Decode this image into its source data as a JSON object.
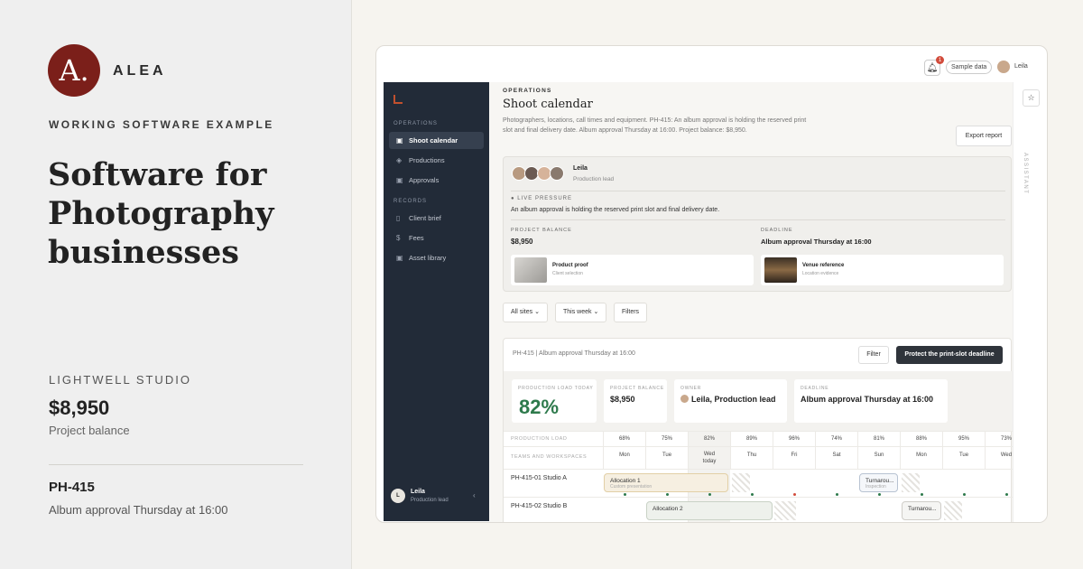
{
  "brand": {
    "logo_letter": "A.",
    "name": "ALEA"
  },
  "hero": {
    "eyebrow": "WORKING SOFTWARE EXAMPLE",
    "headline": "Software for Photography businesses"
  },
  "studio": {
    "name": "LIGHTWELL STUDIO",
    "balance": "$8,950",
    "balance_label": "Project balance",
    "code": "PH-415",
    "code_desc": "Album approval Thursday at 16:00"
  },
  "app": {
    "topbar": {
      "notifications": "1",
      "sample_label": "Sample data",
      "user": "Leila"
    },
    "sidebar": {
      "section_ops": "OPERATIONS",
      "ops_items": [
        {
          "label": "Shoot calendar",
          "icon": "camera-icon",
          "active": true
        },
        {
          "label": "Productions",
          "icon": "layers-icon"
        },
        {
          "label": "Approvals",
          "icon": "camera-icon"
        }
      ],
      "section_records": "RECORDS",
      "record_items": [
        {
          "label": "Client brief",
          "icon": "file-icon"
        },
        {
          "label": "Fees",
          "icon": "dollar-icon"
        },
        {
          "label": "Asset library",
          "icon": "camera-icon"
        }
      ],
      "footer": {
        "initial": "L",
        "name": "Leila",
        "role": "Production lead"
      }
    },
    "page": {
      "eyebrow": "OPERATIONS",
      "title": "Shoot calendar",
      "desc": "Photographers, locations, call times and equipment. PH-415: An album approval is holding the reserved print slot and final delivery date. Album approval Thursday at 16:00. Project balance: $8,950.",
      "export": "Export report"
    },
    "card": {
      "name": "Leila",
      "role": "Production lead",
      "pressure_label": "LIVE PRESSURE",
      "pressure_text": "An album approval is holding the reserved print slot and final delivery date.",
      "balance_label": "PROJECT BALANCE",
      "balance": "$8,950",
      "deadline_label": "DEADLINE",
      "deadline": "Album approval Thursday at 16:00",
      "assets": [
        {
          "title": "Product proof",
          "sub": "Client selection"
        },
        {
          "title": "Venue reference",
          "sub": "Location evidence"
        }
      ]
    },
    "filters": [
      "All sites",
      "This week",
      "Filters"
    ],
    "schedule": {
      "title": "PH-415 | Album approval Thursday at 16:00",
      "filter_btn": "Filter",
      "protect_btn": "Protect the print-slot deadline",
      "kpis": {
        "load_label": "PRODUCTION LOAD TODAY",
        "load_value": "82%",
        "balance_label": "PROJECT BALANCE",
        "balance_value": "$8,950",
        "owner_label": "OWNER",
        "owner_value": "Leila, Production lead",
        "deadline_label": "DEADLINE",
        "deadline_value": "Album approval Thursday at 16:00"
      },
      "load_row_label": "PRODUCTION LOAD",
      "teams_row_label": "TEAMS AND WORKSPACES",
      "loads": [
        "68%",
        "75%",
        "82%",
        "89%",
        "96%",
        "74%",
        "81%",
        "88%",
        "95%",
        "73%"
      ],
      "days": [
        "Mon",
        "Tue",
        "Wed",
        "Thu",
        "Fri",
        "Sat",
        "Sun",
        "Mon",
        "Tue",
        "Wed"
      ],
      "today_label": "today",
      "rows": [
        {
          "name": "PH-415-01 Studio A",
          "blocks": [
            {
              "label": "Allocation 1",
              "sub": "Custom presentation"
            },
            {
              "label": "Turnarou...",
              "sub": "Inspection"
            }
          ]
        },
        {
          "name": "PH-415-02 Studio B",
          "blocks": [
            {
              "label": "Allocation 2"
            },
            {
              "label": "Turnarou..."
            }
          ]
        }
      ]
    },
    "rail": {
      "label": "ASSISTANT"
    },
    "colors": {
      "accent": "#7b1f1a",
      "sidebar": "#222b38",
      "kpi_green": "#2e7a4c",
      "primary_btn": "#2f343b"
    }
  }
}
